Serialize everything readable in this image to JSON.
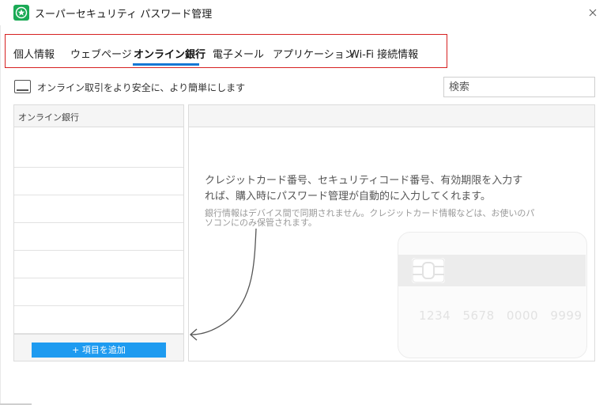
{
  "window": {
    "title": "スーパーセキュリティ パスワード管理",
    "app_icon": "star-icon",
    "close_icon": "close-icon"
  },
  "tabs": [
    {
      "label": "個人情報",
      "active": false
    },
    {
      "label": "ウェブページ",
      "active": false
    },
    {
      "label": "オンライン銀行",
      "active": true
    },
    {
      "label": "電子メール",
      "active": false
    },
    {
      "label": "アプリケーション",
      "active": false
    },
    {
      "label": "Wi-Fi 接続情報",
      "active": false
    }
  ],
  "info": {
    "icon": "card-icon",
    "text": "オンライン取引をより安全に、より簡単にします"
  },
  "search": {
    "placeholder": "検索"
  },
  "list": {
    "header": "オンライン銀行",
    "add_button": "+ 項目を追加"
  },
  "detail": {
    "hint_main": "クレジットカード番号、セキュリティコード番号、有効期限を入力すれば、購入時にパスワード管理が自動的に入力してくれます。",
    "hint_sub": "銀行情報はデバイス間で同期されません。クレジットカード情報などは、お使いのパソコンにのみ保管されます。",
    "card_number": "1234 5678 0000 9999"
  },
  "colors": {
    "accent": "#1477d4",
    "add_button": "#1e9bf0",
    "highlight_border": "#d62020",
    "app_icon": "#1aaa55"
  }
}
